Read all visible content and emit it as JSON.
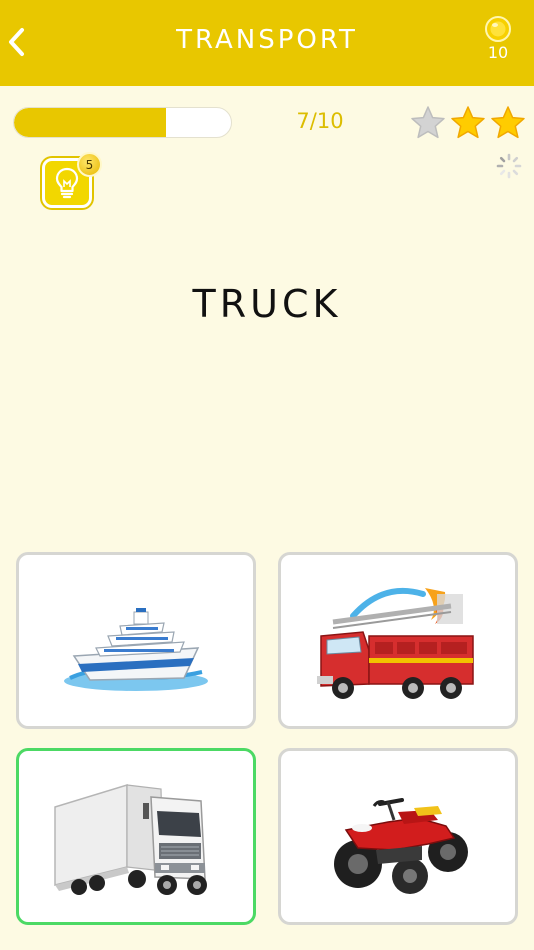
{
  "header": {
    "title": "TRANSPORT",
    "coins": "10",
    "back_icon": "chevron-left-icon",
    "coin_icon": "coin-icon"
  },
  "progress": {
    "current": 7,
    "total": 10,
    "label": "7/10",
    "fill_fraction": 0.7
  },
  "stars": {
    "earned": 2,
    "total": 3
  },
  "hint": {
    "icon": "lightbulb-icon",
    "count": "5"
  },
  "question": {
    "word": "TRUCK"
  },
  "options": [
    {
      "name": "ship",
      "icon": "cruise-ship-image",
      "selected": false
    },
    {
      "name": "fire-truck",
      "icon": "fire-truck-image",
      "selected": false
    },
    {
      "name": "truck",
      "icon": "semi-truck-image",
      "selected": true
    },
    {
      "name": "quad-bike",
      "icon": "quad-bike-image",
      "selected": false
    }
  ],
  "colors": {
    "header": "#e8c700",
    "background": "#fdfae3",
    "correct_border": "#4cd964",
    "card_border": "#d6d6d2"
  }
}
